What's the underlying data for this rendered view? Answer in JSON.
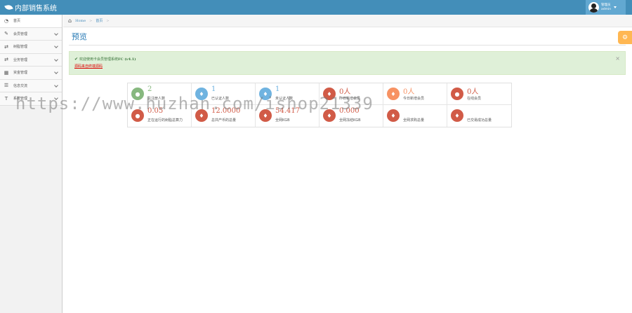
{
  "app": {
    "title": "内部销售系统"
  },
  "user": {
    "role": "管理员",
    "name": "admin"
  },
  "sidebar": {
    "items": [
      {
        "label": "首页",
        "icon": "dashboard-icon",
        "glyph": "◔"
      },
      {
        "label": "会员管理",
        "icon": "edit-icon",
        "glyph": "✎"
      },
      {
        "label": "树脂管理",
        "icon": "shuffle-icon",
        "glyph": "⇄"
      },
      {
        "label": "业务管理",
        "icon": "shuffle-icon",
        "glyph": "⇄"
      },
      {
        "label": "资金管理",
        "icon": "calendar-icon",
        "glyph": "▦"
      },
      {
        "label": "信息交流",
        "icon": "list-icon",
        "glyph": "☰"
      },
      {
        "label": "系统管理",
        "icon": "text-icon",
        "glyph": "T"
      }
    ]
  },
  "breadcrumb": {
    "home": "Home",
    "current": "首页"
  },
  "page": {
    "title": "预览"
  },
  "alert": {
    "welcome": "欢迎使用卡会员管理系统",
    "version": "FC (v4.1)",
    "note": "源码来自终端源码"
  },
  "stats": [
    {
      "value": "2",
      "label": "总注册人数",
      "icon": "comments-icon",
      "color": "#87b87f"
    },
    {
      "value": "1",
      "label": "已认证人数",
      "icon": "twitter-icon",
      "color": "#6fb3e0"
    },
    {
      "value": "1",
      "label": "未认证人数",
      "icon": "twitter-icon",
      "color": "#6fb3e0"
    },
    {
      "value": "0人",
      "label": "昨日新增会员",
      "icon": "twitter-icon",
      "color": "#d15b47"
    },
    {
      "value": "0人",
      "label": "今日新增会员",
      "icon": "twitter-icon",
      "color": "#f79263"
    },
    {
      "value": "0人",
      "label": "在线会员",
      "icon": "comments-icon",
      "color": "#d15b47"
    },
    {
      "value": "0.05",
      "label": "正在运行的树脂总算力",
      "icon": "comments-icon",
      "color": "#d15b47"
    },
    {
      "value": "12.0000",
      "label": "总共产币的总量",
      "icon": "twitter-icon",
      "color": "#d15b47"
    },
    {
      "value": "54.417",
      "label": "全网KGB",
      "icon": "twitter-icon",
      "color": "#d15b47"
    },
    {
      "value": "0.000",
      "label": "全网冻结KGB",
      "icon": "twitter-icon",
      "color": "#d15b47"
    },
    {
      "value": "",
      "label": "全网求购总量",
      "icon": "twitter-icon",
      "color": "#d15b47"
    },
    {
      "value": "",
      "label": "已交易成功总量",
      "icon": "twitter-icon",
      "color": "#d15b47"
    }
  ],
  "watermark": "https://www.huzhan.com/ishop21339"
}
